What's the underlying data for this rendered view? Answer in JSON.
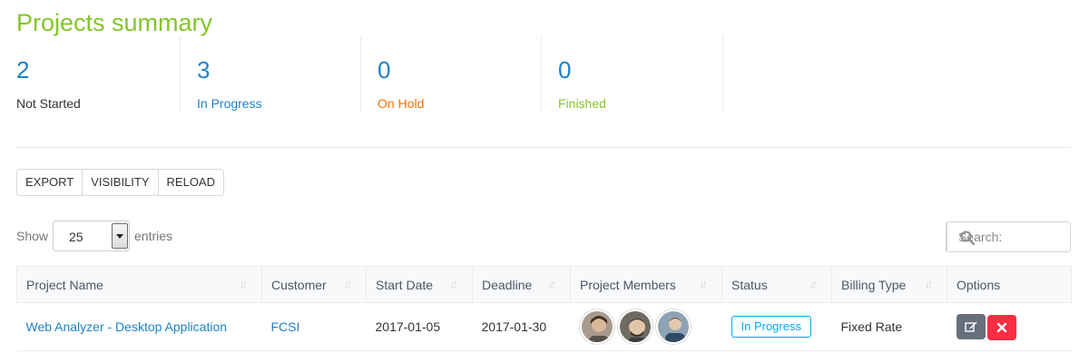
{
  "page": {
    "title": "Projects summary"
  },
  "summary": [
    {
      "count": "2",
      "label": "Not Started",
      "color": "#333333",
      "count_color": "#1d83c5"
    },
    {
      "count": "3",
      "label": "In Progress",
      "color": "#1d83c5",
      "count_color": "#1d83c5"
    },
    {
      "count": "0",
      "label": "On Hold",
      "color": "#ff6f00",
      "count_color": "#1d83c5"
    },
    {
      "count": "0",
      "label": "Finished",
      "color": "#84c529",
      "count_color": "#1d83c5"
    }
  ],
  "toolbar": {
    "export_label": "EXPORT",
    "visibility_label": "VISIBILITY",
    "reload_label": "RELOAD"
  },
  "length": {
    "show_label": "Show",
    "value": "25",
    "entries_label": "entries"
  },
  "search": {
    "placeholder": "Search:",
    "icon": "search-icon"
  },
  "table": {
    "headers": [
      "Project Name",
      "Customer",
      "Start Date",
      "Deadline",
      "Project Members",
      "Status",
      "Billing Type",
      "Options"
    ],
    "rows": [
      {
        "project_name": "Web Analyzer - Desktop Application",
        "customer": "FCSI",
        "start_date": "2017-01-05",
        "deadline": "2017-01-30",
        "members": [
          "member-1",
          "member-2",
          "member-3"
        ],
        "status": "In Progress",
        "billing_type": "Fixed Rate",
        "options": [
          "edit-icon",
          "delete-icon"
        ]
      }
    ]
  },
  "colors": {
    "accent_green": "#84c529",
    "link_blue": "#1d83c5",
    "status_blue": "#03a9f4",
    "danger": "#fc2d42",
    "edit_gray": "#676f7d"
  }
}
